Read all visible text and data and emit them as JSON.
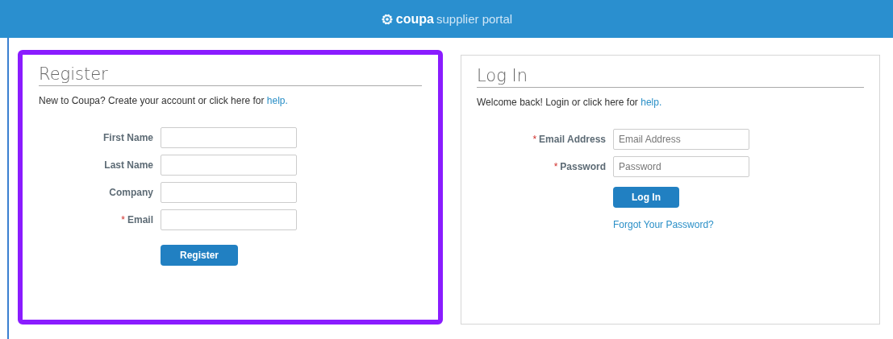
{
  "header": {
    "brand": "coupa",
    "product": "supplier portal"
  },
  "register": {
    "title": "Register",
    "intro": "New to Coupa? Create your account or click here for ",
    "help_link": "help.",
    "highlighted": true,
    "fields": [
      {
        "label": "First Name"
      },
      {
        "label": "Last Name"
      },
      {
        "label": "Company"
      },
      {
        "label": "Email",
        "required_mark": "*"
      }
    ],
    "button": "Register"
  },
  "login": {
    "title": "Log In",
    "intro": "Welcome back! Login or click here for ",
    "help_link": "help.",
    "fields": [
      {
        "label": "Email Address",
        "required_mark": "*",
        "placeholder": "Email Address"
      },
      {
        "label": "Password",
        "required_mark": "*",
        "placeholder": "Password"
      }
    ],
    "button": "Log In",
    "forgot_link": "Forgot Your Password?"
  }
}
